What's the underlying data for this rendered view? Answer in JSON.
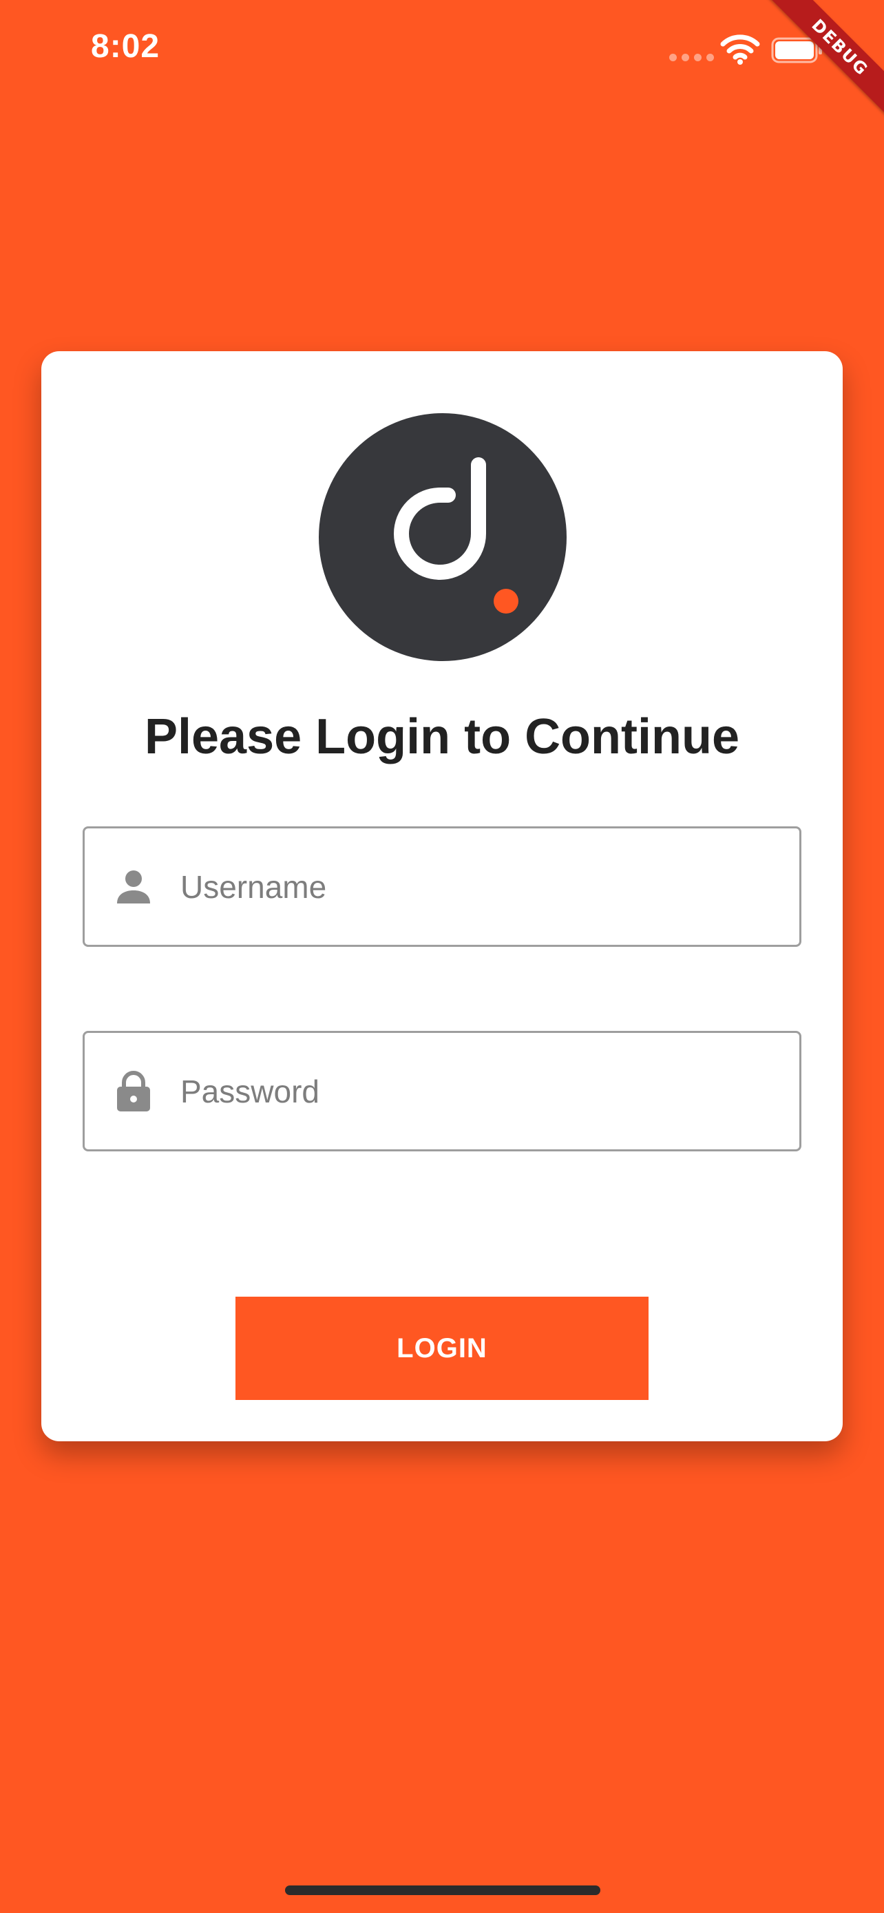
{
  "status_bar": {
    "time": "8:02"
  },
  "debug_banner": "DEBUG",
  "login_card": {
    "title": "Please Login to Continue",
    "username": {
      "placeholder": "Username",
      "icon": "person-icon"
    },
    "password": {
      "placeholder": "Password",
      "icon": "lock-icon"
    },
    "login_button": "LOGIN"
  },
  "colors": {
    "background": "#FF5722",
    "card": "#FFFFFF",
    "logo_circle": "#37383C",
    "logo_dot": "#FF5722",
    "title_text": "#222222",
    "placeholder": "#7D7D7D",
    "field_border": "#9E9E9E",
    "debug_ribbon": "#B71C1C"
  }
}
